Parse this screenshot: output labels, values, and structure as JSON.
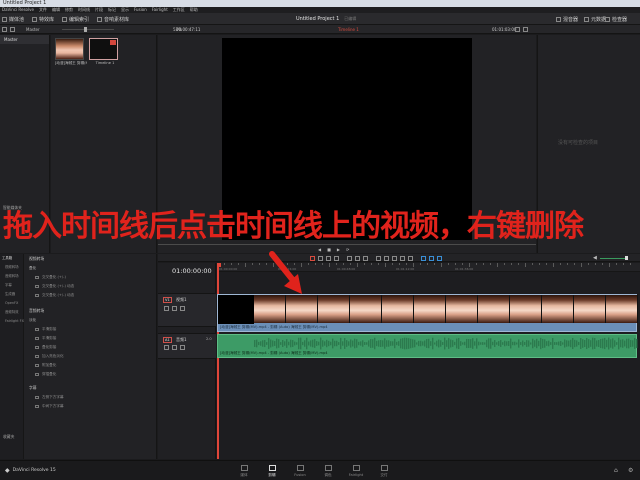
{
  "window": {
    "title": "Untitled Project 1"
  },
  "menu": [
    "DaVinci Resolve",
    "文件",
    "编辑",
    "修剪",
    "时间线",
    "片段",
    "标记",
    "显示",
    "Fusion",
    "Fairlight",
    "工作区",
    "帮助"
  ],
  "toolbar": {
    "media_pool": "媒体池",
    "effects_library": "特效库",
    "edit_index": "编辑索引",
    "sound_library": "音响素材库",
    "project_title": "Untitled Project 1",
    "project_status": "已编辑",
    "mixer": "混音器",
    "metadata": "元数据",
    "inspector": "检查器"
  },
  "subbar": {
    "bin": "Master",
    "zoom": "53%",
    "source_tc": "00:00:47:11",
    "timeline_name": "Timeline 1",
    "record_tc": "01:01:03:00"
  },
  "media_pool": {
    "bins": [
      "Master"
    ],
    "clips": [
      {
        "name": "[动漫]海贼王 剪辑(MV).mp4"
      },
      {
        "name": "Timeline 1"
      }
    ],
    "smart_bins": "智能媒体夹"
  },
  "inspector_empty": "没有可检查的项目",
  "overlay_caption": "拖入时间线后点击时间线上的视频，右键删除",
  "effects_library": {
    "tree": [
      "工具箱",
      "视频转场",
      "音频转场",
      "字幕",
      "生成器",
      "OpenFX",
      "音频特效",
      "Fairlight FX"
    ],
    "section_video": "视频转场",
    "sub_dissolve": "叠化",
    "video_items": [
      "交叉叠化 (+/-)",
      "交叉叠化 (+/-) 动态",
      "交叉叠化 (+/-) 动态"
    ],
    "section_audio": "音频转场",
    "sub_fade": "淡化",
    "audio_items": [
      "平滑剪接",
      "平滑剪接",
      "叠化剪接",
      "加入亮色淡化",
      "附加叠化",
      "穿插叠化"
    ],
    "section_titles": "字幕",
    "title_items": [
      "左侧下方字幕",
      "中间下方字幕"
    ],
    "favorites": "收藏夹"
  },
  "timeline": {
    "timecode": "01:00:00:00",
    "video_track": {
      "id": "V1",
      "name": "视频1"
    },
    "audio_track": {
      "id": "A1",
      "name": "音频1",
      "level": "2.0"
    },
    "video_clip_label": "[动漫]海贼王 剪辑(MV).mp4 - 剪辑 (Auto) 海贼王 剪辑(MV).mp4",
    "audio_clip_label": "[动漫]海贼王 剪辑(MV).mp4 - 剪辑 (Auto) 海贼王 剪辑(MV).mp4",
    "ruler_marks": [
      "01:00:00:00",
      "01:00:24:00",
      "01:00:48:00",
      "01:01:12:00",
      "01:01:36:00"
    ]
  },
  "pages": [
    {
      "label": "媒体",
      "active": false
    },
    {
      "label": "剪辑",
      "active": true
    },
    {
      "label": "Fusion",
      "active": false
    },
    {
      "label": "调色",
      "active": false
    },
    {
      "label": "Fairlight",
      "active": false
    },
    {
      "label": "交付",
      "active": false
    }
  ],
  "bottom": {
    "app_name": "DaVinci Resolve 15"
  },
  "colors": {
    "caption_red": "#e0231c",
    "playhead_red": "#e0463a",
    "video_track_blue": "#6b8fb8",
    "audio_track_green": "#3d9b66",
    "audio_track_label": "#5aa67a"
  }
}
